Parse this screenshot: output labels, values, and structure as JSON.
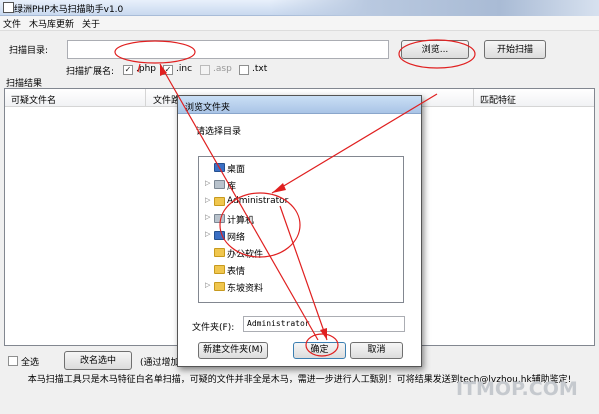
{
  "window": {
    "title": "绿洲PHP木马扫描助手v1.0"
  },
  "menu": {
    "items": [
      "文件",
      "木马库更新",
      "关于"
    ]
  },
  "scan": {
    "dir_label": "扫描目录:",
    "dir_value": "",
    "browse_button": "浏览...",
    "start_button": "开始扫描",
    "ext_label": "扫描扩展名:",
    "extensions": [
      {
        "label": ".php",
        "checked": true,
        "enabled": true
      },
      {
        "label": ".inc",
        "checked": true,
        "enabled": true
      },
      {
        "label": ".asp",
        "checked": false,
        "enabled": false
      },
      {
        "label": ".txt",
        "checked": false,
        "enabled": true
      }
    ]
  },
  "results": {
    "group_label": "扫描结果",
    "columns": [
      "可疑文件名",
      "文件路",
      "匹配特征"
    ]
  },
  "bottom": {
    "select_all": "全选",
    "rename_button": "改名选中",
    "note": "(通过增加"
  },
  "footer": {
    "text": "本马扫描工具只是木马特征白名单扫描，可疑的文件并非全是木马，需进一步进行人工甄别！可将结果发送到tech@lvzhou.hk辅助鉴定!"
  },
  "dialog": {
    "title": "浏览文件夹",
    "prompt": "请选择目录",
    "tree": [
      {
        "label": "桌面",
        "icon": "desktop-icon",
        "expander": "",
        "level": 0
      },
      {
        "label": "库",
        "icon": "library-icon",
        "expander": "▷",
        "level": 1
      },
      {
        "label": "Administrator",
        "icon": "user-folder-icon",
        "expander": "▷",
        "level": 1
      },
      {
        "label": "计算机",
        "icon": "computer-icon",
        "expander": "▷",
        "level": 1
      },
      {
        "label": "网络",
        "icon": "network-icon",
        "expander": "▷",
        "level": 1
      },
      {
        "label": "办公软件",
        "icon": "folder-icon",
        "expander": "",
        "level": 1
      },
      {
        "label": "表情",
        "icon": "folder-icon",
        "expander": "",
        "level": 1
      },
      {
        "label": "东坡资料",
        "icon": "folder-icon",
        "expander": "▷",
        "level": 1
      }
    ],
    "folder_label": "文件夹(F):",
    "folder_value": "Administrator",
    "new_folder_button": "新建文件夹(M)",
    "ok_button": "确定",
    "cancel_button": "取消"
  },
  "watermark": "ITMOP.COM",
  "colors": {
    "annotation": "#e02020",
    "title_gradient_top": "#e8f0fb",
    "dialog_title": "#a9c4e6"
  }
}
